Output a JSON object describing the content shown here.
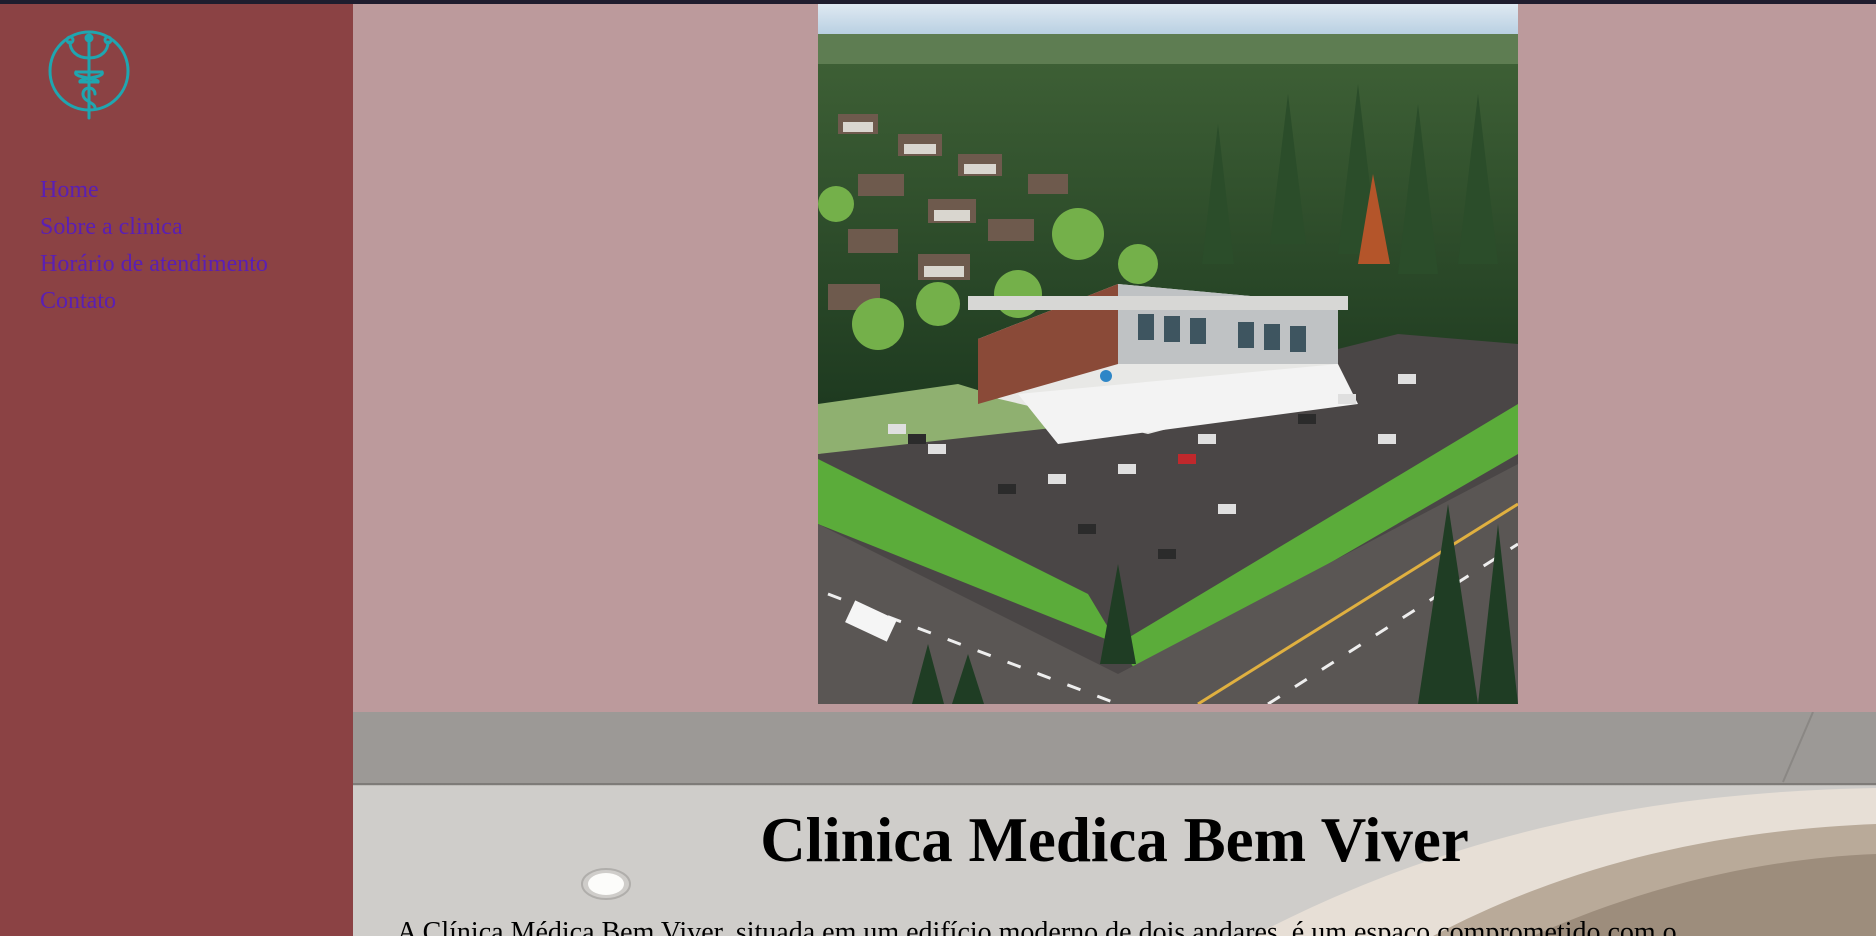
{
  "sidebar": {
    "logo_icon": "caduceus-icon",
    "nav": [
      {
        "label": "Home"
      },
      {
        "label": "Sobre a clinica"
      },
      {
        "label": "Horário de atendimento"
      },
      {
        "label": "Contato"
      }
    ]
  },
  "hero": {
    "image": "aerial-clinic-building-photo"
  },
  "intro": {
    "title": "Clinica Medica Bem Viver",
    "paragraph": "A Clínica Médica Bem Viver, situada em um edifício moderno de dois andares, é um espaço comprometido com o"
  },
  "colors": {
    "sidebar_bg": "#8b4244",
    "hero_bg": "#bc9a9c",
    "link": "#5a1fb4",
    "logo": "#1fa6b0"
  }
}
